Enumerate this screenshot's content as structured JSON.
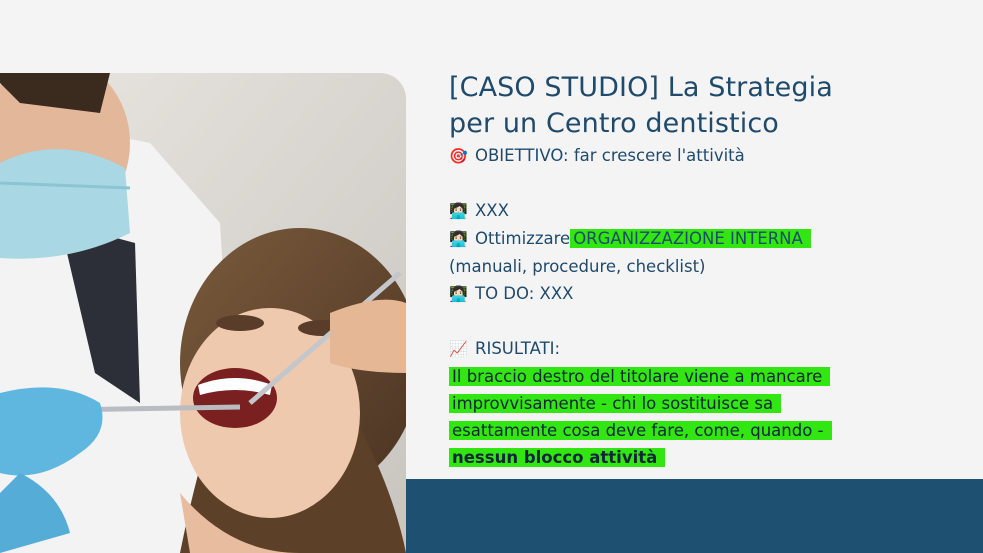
{
  "slide": {
    "title_line1": "[CASO STUDIO] La Strategia",
    "title_line2": "per un Centro dentistico",
    "objective_icon": "target-emoji",
    "objective": "OBIETTIVO: far crescere l'attività",
    "items": [
      {
        "icon": "technologist-emoji",
        "text": "XXX"
      },
      {
        "icon": "technologist-emoji",
        "text_plain": "Ottimizzare",
        "text_highlight": "ORGANIZZAZIONE INTERNA",
        "text_cont": "(manuali, procedure, checklist)"
      },
      {
        "icon": "technologist-emoji",
        "text": "TO DO: XXX"
      }
    ],
    "results_icon": "chart-increasing-emoji",
    "results_label": "RISULTATI:",
    "results_lines": [
      "Il braccio destro del titolare viene a mancare",
      "improvvisamente - chi lo sostituisce sa",
      "esattamente cosa deve fare, come, quando -"
    ],
    "results_bold": "nessun blocco attività",
    "colors": {
      "title": "#1f4a6b",
      "highlight": "#31e611",
      "band": "#1d5071",
      "background": "#f4f4f4"
    }
  }
}
